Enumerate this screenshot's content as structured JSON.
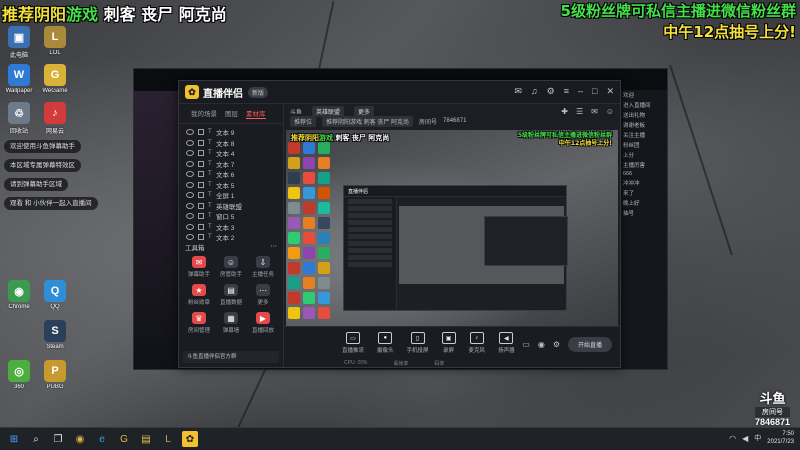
{
  "overlay": {
    "top_left_yellow": "推荐阴阳",
    "top_left_green": "游戏",
    "top_left_white": "刺客 丧尸  阿克尚",
    "top_right_line1": "5级粉丝牌可私信主播进微信粉丝群",
    "top_right_line2": "中午12点抽号上分!",
    "left_lines": [
      "欢迎使用斗鱼弹幕助手",
      "本区域专属弹幕特效区",
      "请到弹幕助手区域",
      "观看 和 小伙伴一起入直播间"
    ]
  },
  "desktop_icons": [
    {
      "label": "此电脑",
      "glyph": "▣",
      "color": "#3a6fb0"
    },
    {
      "label": "Wallpaper",
      "glyph": "W",
      "color": "#2e7bd6"
    },
    {
      "label": "回收站",
      "glyph": "♲",
      "color": "#6d7a8a"
    },
    {
      "label": "LOL",
      "glyph": "L",
      "color": "#a98a3a"
    },
    {
      "label": "WeGame",
      "glyph": "G",
      "color": "#d9b23a"
    },
    {
      "label": "网易云",
      "glyph": "♪",
      "color": "#d13b3b"
    },
    {
      "label": "Chrome",
      "glyph": "◉",
      "color": "#3a9a4f"
    },
    {
      "label": "QQ",
      "glyph": "Q",
      "color": "#2f8fd6"
    },
    {
      "label": "Steam",
      "glyph": "S",
      "color": "#2a3f5a"
    },
    {
      "label": "PUBG",
      "glyph": "P",
      "color": "#c79a2e"
    },
    {
      "label": "360",
      "glyph": "◎",
      "color": "#4cae3c"
    }
  ],
  "window": {
    "app_name": "直播伴侣",
    "version_badge": "新版",
    "tabs": [
      "我的场景",
      "图层",
      "素材库"
    ],
    "active_tab": "素材库",
    "scene_items": [
      "文本 9",
      "文本 8",
      "文本 4",
      "文本 7",
      "文本 6",
      "文本 5",
      "全屏 1",
      "英雄联盟",
      "窗口 5",
      "文本 3",
      "文本 2"
    ],
    "tool_header": "工具箱",
    "tools": [
      {
        "label": "弹幕助手",
        "color": "#e34b4b",
        "glyph": "✉"
      },
      {
        "label": "房管助手",
        "color": "#3a3d46",
        "glyph": "☺"
      },
      {
        "label": "主播任务",
        "color": "#3a3d46",
        "glyph": "⇩"
      },
      {
        "label": "粉丝勋章",
        "color": "#e34b4b",
        "glyph": "★"
      },
      {
        "label": "直播数据",
        "color": "#3a3d46",
        "glyph": "▤"
      },
      {
        "label": "更多",
        "color": "#3a3d46",
        "glyph": "⋯"
      },
      {
        "label": "房间管理",
        "color": "#e34b4b",
        "glyph": "♛"
      },
      {
        "label": "弹幕墙",
        "color": "#3a3d46",
        "glyph": "▦"
      },
      {
        "label": "直播回放",
        "color": "#e34b4b",
        "glyph": "▶"
      }
    ],
    "side_footer": "斗鱼直播伴侣官方群",
    "top_info": {
      "room_label": "斗鱼",
      "room_type": "英雄联盟",
      "title_label": "推荐位",
      "title_value": "推荐阴阳游戏 刺客 丧尸  阿克尚",
      "room_id_label": "房间号",
      "room_id": "7846871"
    },
    "bottom_tools": [
      {
        "label": "直播推流",
        "glyph": "▭"
      },
      {
        "label": "摄像头",
        "glyph": "●"
      },
      {
        "label": "手机投屏",
        "glyph": "▯"
      },
      {
        "label": "录屏",
        "glyph": "▣"
      },
      {
        "label": "麦克风",
        "glyph": "♪"
      },
      {
        "label": "扬声器",
        "glyph": "◀"
      }
    ],
    "start_button": "开始直播",
    "status_items": [
      "CPU: 20%",
      "丢帧率",
      "码率"
    ]
  },
  "chat_lines": [
    "欢迎",
    "进入直播间",
    "送出礼物",
    "谢谢老板",
    "关注主播",
    "粉丝团",
    "上分",
    "主播厉害",
    "666",
    "冲冲冲",
    "来了",
    "晚上好",
    "抽号"
  ],
  "watermark": {
    "logo": "斗鱼",
    "sub": "房间号",
    "room_id": "7846871"
  },
  "taskbar": {
    "time": "7:50",
    "date": "2021/7/23"
  }
}
